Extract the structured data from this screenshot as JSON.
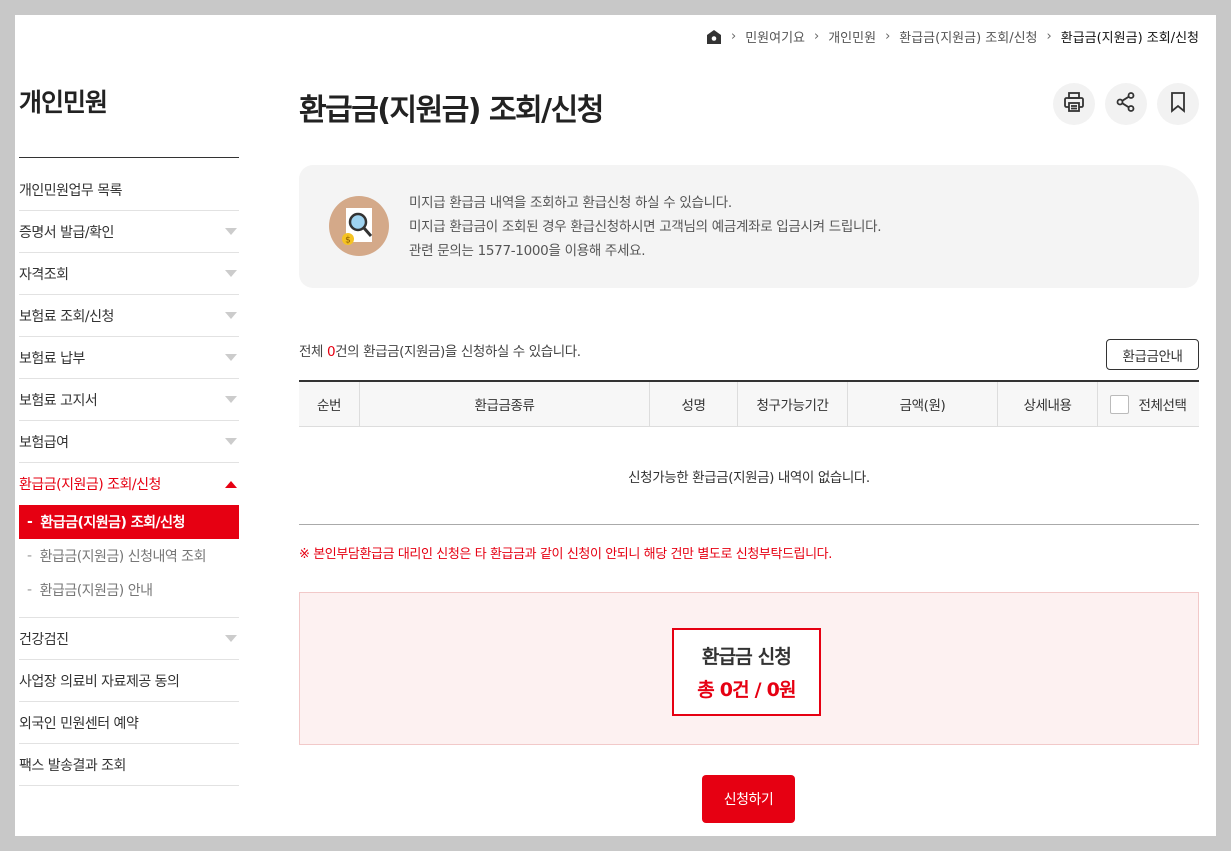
{
  "breadcrumb": {
    "home_icon": "home-icon",
    "items": [
      "민원여기요",
      "개인민원",
      "환급금(지원금) 조회/신청"
    ],
    "current": "환급금(지원금) 조회/신청"
  },
  "sidebar": {
    "title": "개인민원",
    "items": [
      {
        "label": "개인민원업무 목록",
        "has_arrow": false
      },
      {
        "label": "증명서 발급/확인",
        "has_arrow": true
      },
      {
        "label": "자격조회",
        "has_arrow": true
      },
      {
        "label": "보험료 조회/신청",
        "has_arrow": true
      },
      {
        "label": "보험료 납부",
        "has_arrow": true
      },
      {
        "label": "보험료 고지서",
        "has_arrow": true
      },
      {
        "label": "보험급여",
        "has_arrow": true
      },
      {
        "label": "환급금(지원금) 조회/신청",
        "has_arrow": true,
        "active": true
      }
    ],
    "sub_items": [
      {
        "label": "환급금(지원금) 조회/신청",
        "selected": true
      },
      {
        "label": "환급금(지원금) 신청내역 조회",
        "selected": false
      },
      {
        "label": "환급금(지원금) 안내",
        "selected": false
      }
    ],
    "items_after": [
      {
        "label": "건강검진",
        "has_arrow": true
      },
      {
        "label": "사업장 의료비 자료제공 동의",
        "has_arrow": false
      },
      {
        "label": "외국인 민원센터 예약",
        "has_arrow": false
      },
      {
        "label": "팩스 발송결과 조회",
        "has_arrow": false
      }
    ]
  },
  "main": {
    "title": "환급금(지원금) 조회/신청",
    "tools": [
      "print-icon",
      "share-icon",
      "bookmark-icon"
    ],
    "info": {
      "icon": "search-refund-icon",
      "lines": [
        "미지급 환급금 내역을 조회하고 환급신청 하실 수 있습니다.",
        "미지급 환급금이 조회된 경우 환급신청하시면 고객님의 예금계좌로 입금시켜 드립니다.",
        "관련 문의는 1577-1000을 이용해 주세요."
      ]
    },
    "count": {
      "prefix": "전체 ",
      "number": "0",
      "suffix": "건의 환급금(지원금)을 신청하실 수 있습니다."
    },
    "guide_button": "환급금안내",
    "table": {
      "headers": [
        "순번",
        "환급금종류",
        "성명",
        "청구가능기간",
        "금액(원)",
        "상세내용",
        "전체선택"
      ],
      "empty_message": "신청가능한 환급금(지원금) 내역이 없습니다."
    },
    "notice": "※ 본인부담환급금 대리인 신청은 타 환급금과 같이 신청이 안되니 해당 건만 별도로 신청부탁드립니다.",
    "summary": {
      "title": "환급금 신청",
      "value": "총 0건 / 0원"
    },
    "apply_button": "신청하기"
  },
  "colors": {
    "accent": "#e60012",
    "background": "#c8c8c8"
  }
}
